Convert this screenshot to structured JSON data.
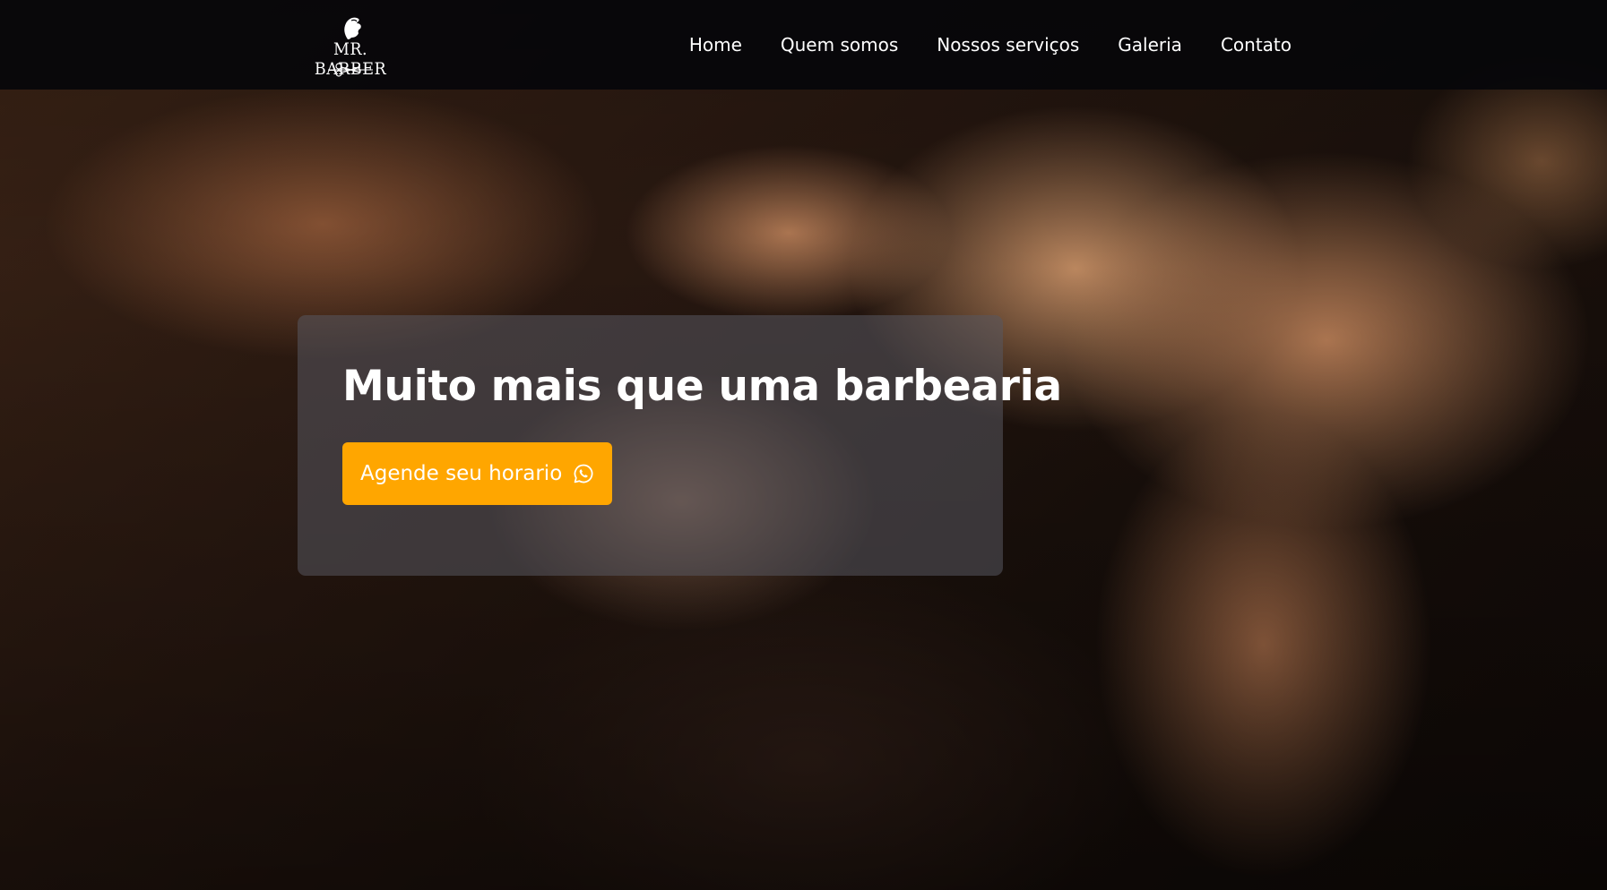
{
  "header": {
    "logo_alt": "MR. BARBER",
    "logo_text": "MR. BARBER",
    "logo_icons": [
      "barber-head-icon",
      "scissors-icon"
    ],
    "nav": [
      {
        "label": "Home"
      },
      {
        "label": "Quem somos"
      },
      {
        "label": "Nossos serviços"
      },
      {
        "label": "Galeria"
      },
      {
        "label": "Contato"
      }
    ]
  },
  "hero": {
    "title": "Muito mais que uma barbearia",
    "cta_label": "Agende seu horario",
    "cta_icon": "whatsapp-icon"
  },
  "colors": {
    "accent": "#ffa600",
    "navbar_bg": "#06060a",
    "text": "#ffffff"
  }
}
